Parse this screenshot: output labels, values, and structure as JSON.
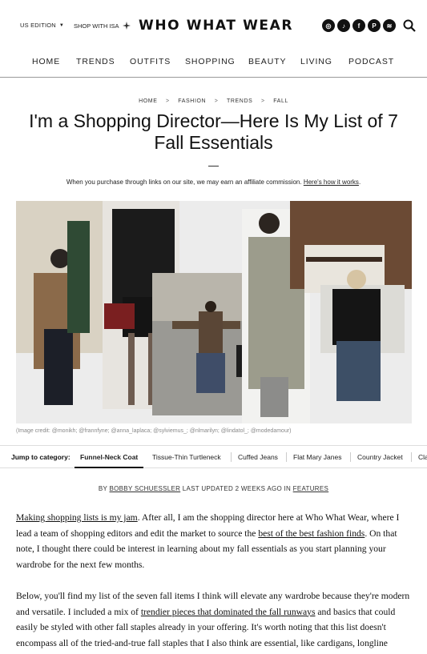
{
  "header": {
    "edition_label": "US EDITION",
    "shop_label": "SHOP WITH ISA",
    "logo": "WHO WHAT WEAR",
    "social_icons": [
      "instagram-icon",
      "tiktok-icon",
      "facebook-icon",
      "pinterest-icon",
      "rss-icon"
    ],
    "social_glyphs": [
      "◎",
      "♪",
      "f",
      "P",
      "≋"
    ]
  },
  "nav": {
    "items": [
      "HOME",
      "TRENDS",
      "OUTFITS",
      "SHOPPING",
      "BEAUTY",
      "LIVING",
      "PODCAST"
    ]
  },
  "breadcrumb": [
    "HOME",
    "FASHION",
    "TRENDS",
    "FALL"
  ],
  "breadcrumb_separator": ">",
  "article": {
    "title": "I'm a Shopping Director—Here Is My List of 7 Fall Essentials",
    "affiliate_text": "When you purchase through links on our site, we may earn an affiliate commission.",
    "affiliate_link": "Here's how it works",
    "affiliate_end": ".",
    "image_credit": "(Image credit: @monikh; @frannfyne; @anna_laplaca; @sylviemus_; @nlmarilyn; @lindatol_; @modedamour)",
    "byline_prefix": "BY",
    "author": "BOBBY SCHUESSLER",
    "updated": "LAST UPDATED 2 WEEKS AGO IN",
    "section": "FEATURES",
    "p1_link1": "Making shopping lists is my jam",
    "p1_text1": ". After all, I am the shopping director here at Who What Wear, where I lead a team of shopping editors and edit the market to source the",
    "p1_link2": "best of the best fashion finds",
    "p1_text2": ". On that note, I thought there could be interest in learning about my fall essentials as you start planning your wardrobe for the next few months.",
    "p2_text1": "Below, you'll find my list of the seven fall items I think will elevate any wardrobe because they're modern and versatile. I included a mix of",
    "p2_link1": "trendier pieces that dominated the fall runways",
    "p2_text2": "and basics that could easily be styled with other fall staples already in your offering. It's worth noting that this list doesn't encompass all of the tried-and-true fall staples that I also think are essential, like cardigans, longline"
  },
  "jump": {
    "label": "Jump to category:",
    "items": [
      "Funnel-Neck Coat",
      "Tissue-Thin Turtleneck",
      "Cuffed Jeans",
      "Flat Mary Janes",
      "Country Jacket",
      "Cla"
    ]
  },
  "colors": {
    "text": "#111111",
    "rule": "#999999",
    "credit": "#888888"
  }
}
